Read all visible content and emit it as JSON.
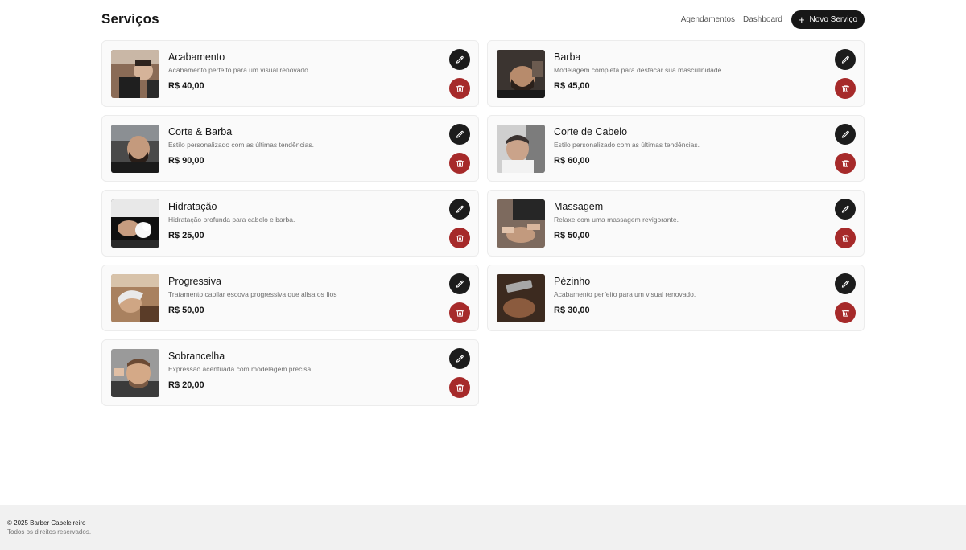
{
  "header": {
    "title": "Serviços",
    "nav": [
      "Agendamentos",
      "Dashboard"
    ],
    "new_button": "Novo Serviço"
  },
  "services": [
    {
      "name": "Acabamento",
      "description": "Acabamento perfeito para um visual renovado.",
      "price": "R$ 40,00"
    },
    {
      "name": "Barba",
      "description": "Modelagem completa para destacar sua masculinidade.",
      "price": "R$ 45,00"
    },
    {
      "name": "Corte & Barba",
      "description": "Estilo personalizado com as últimas tendências.",
      "price": "R$ 90,00"
    },
    {
      "name": "Corte de Cabelo",
      "description": "Estilo personalizado com as últimas tendências.",
      "price": "R$ 60,00"
    },
    {
      "name": "Hidratação",
      "description": "Hidratação profunda para cabelo e barba.",
      "price": "R$ 25,00"
    },
    {
      "name": "Massagem",
      "description": "Relaxe com uma massagem revigorante.",
      "price": "R$ 50,00"
    },
    {
      "name": "Progressiva",
      "description": "Tratamento capilar escova progressiva que alisa os fios",
      "price": "R$ 50,00"
    },
    {
      "name": "Pézinho",
      "description": "Acabamento perfeito para um visual renovado.",
      "price": "R$ 30,00"
    },
    {
      "name": "Sobrancelha",
      "description": "Expressão acentuada com modelagem precisa.",
      "price": "R$ 20,00"
    }
  ],
  "footer": {
    "copyright": "© 2025 Barber Cabeleireiro",
    "rights": "Todos os direitos reservados."
  },
  "colors": {
    "primary": "#171717",
    "danger": "#a62a2a",
    "card_bg": "#fafafa",
    "footer_bg": "#f1f1f1"
  },
  "icons": {
    "edit": "pencil-icon",
    "delete": "trash-icon",
    "add": "plus-icon"
  }
}
